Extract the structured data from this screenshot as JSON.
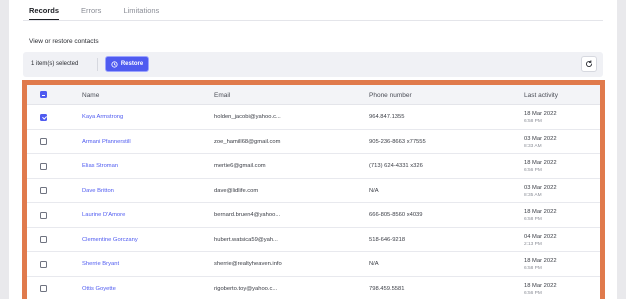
{
  "tabs": [
    {
      "label": "Records",
      "active": true
    },
    {
      "label": "Errors",
      "active": false
    },
    {
      "label": "Limitations",
      "active": false
    }
  ],
  "section_title": "View or restore contacts",
  "toolbar": {
    "selected_text": "1 item(s) selected",
    "restore_label": "Restore",
    "refresh_icon": "refresh-icon",
    "restore_icon": "restore-clock-icon"
  },
  "colors": {
    "accent": "#4f5bf0",
    "highlight_border": "#e07a4c"
  },
  "table": {
    "columns": [
      "Name",
      "Email",
      "Phone number",
      "Last activity"
    ],
    "header_checkbox": "indeterminate",
    "rows": [
      {
        "checked": true,
        "name": "Kaya Armstrong",
        "email": "holden_jacobi@yahoo.c...",
        "phone": "964.847.1355",
        "date": "18 Mar 2022",
        "time": "6:58 PM"
      },
      {
        "checked": false,
        "name": "Armani Pfannerstill",
        "email": "zoe_hamill68@gmail.com",
        "phone": "905-236-8663 x77555",
        "date": "03 Mar 2022",
        "time": "8:33 AM"
      },
      {
        "checked": false,
        "name": "Elias Stroman",
        "email": "mertie6@gmail.com",
        "phone": "(713) 624-4331 x326",
        "date": "18 Mar 2022",
        "time": "6:56 PM"
      },
      {
        "checked": false,
        "name": "Dave Britton",
        "email": "dave@lidlife.com",
        "phone": "N/A",
        "date": "03 Mar 2022",
        "time": "8:35 AM"
      },
      {
        "checked": false,
        "name": "Laurine D'Amore",
        "email": "bernard.bruen4@yahoo...",
        "phone": "666-805-8560 x4039",
        "date": "18 Mar 2022",
        "time": "6:58 PM"
      },
      {
        "checked": false,
        "name": "Clementine Gorczany",
        "email": "hubert.watsica59@yah...",
        "phone": "518-646-9218",
        "date": "04 Mar 2022",
        "time": "2:13 PM"
      },
      {
        "checked": false,
        "name": "Sherrie Bryant",
        "email": "sherrie@realtyheaven.info",
        "phone": "N/A",
        "date": "18 Mar 2022",
        "time": "6:58 PM"
      },
      {
        "checked": false,
        "name": "Ottis Goyette",
        "email": "rigoberto.toy@yahoo.c...",
        "phone": "798.459.5581",
        "date": "18 Mar 2022",
        "time": "6:56 PM"
      }
    ]
  }
}
